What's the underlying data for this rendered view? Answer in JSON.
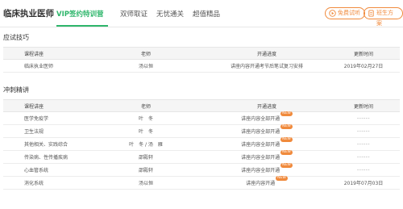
{
  "header": {
    "brand": "临床执业医师",
    "tabs": [
      {
        "label": "VIP签约特训营",
        "active": true
      },
      {
        "label": "双师取证",
        "active": false
      },
      {
        "label": "无忧通关",
        "active": false
      },
      {
        "label": "超值精品",
        "active": false
      }
    ],
    "buttons": {
      "trial": "免费试听",
      "plan": "班生方案"
    },
    "accent": "#2eb66b",
    "orange": "#f08a3c"
  },
  "section1": {
    "title": "应试技巧",
    "columns": [
      "课程讲座",
      "老师",
      "开通进度",
      "更新时间"
    ],
    "rows": [
      {
        "course": "临床执业医师",
        "teacher": "汤以恒",
        "progress": "讲座内容开通考节后笔试复习安排",
        "new": false,
        "updated": "2019年02月27日"
      }
    ]
  },
  "section2": {
    "title": "冲刺精讲",
    "columns": [
      "课程讲座",
      "老师",
      "开通进度",
      "更新时间"
    ],
    "rows": [
      {
        "course": "医学免疫学",
        "teacher": "叶　冬",
        "progress": "讲座内容全部开通",
        "new": true,
        "badge": "NEW",
        "updated": "------"
      },
      {
        "course": "卫生法规",
        "teacher": "叶　冬",
        "progress": "讲座内容全部开通",
        "new": true,
        "badge": "NEW",
        "updated": "------"
      },
      {
        "course": "其他相关、实践综合",
        "teacher": "叶　冬 / 汤　雁",
        "progress": "讲座内容全部开通",
        "new": true,
        "badge": "NEW",
        "updated": "------"
      },
      {
        "course": "传染病、性传播疾病",
        "teacher": "邵殿轩",
        "progress": "讲座内容全部开通",
        "new": true,
        "badge": "NEW",
        "updated": "------"
      },
      {
        "course": "心血管系统",
        "teacher": "邵殿轩",
        "progress": "讲座内容全部开通",
        "new": true,
        "badge": "NEW",
        "updated": "------"
      },
      {
        "course": "消化系统",
        "teacher": "汤以恒",
        "progress": "讲座内容开通",
        "new": true,
        "badge": "NEW",
        "updated": "2019年07月03日"
      }
    ]
  }
}
